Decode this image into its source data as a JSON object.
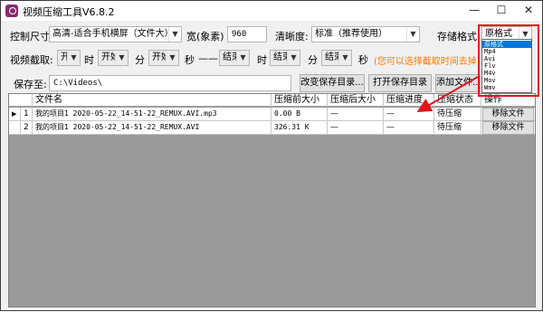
{
  "window": {
    "title": "视频压缩工具V6.8.2",
    "minimize": "—",
    "maximize": "☐",
    "close": "✕"
  },
  "row1": {
    "control_size_label": "控制尺寸:",
    "control_size_value": "高清-适合手机横屏（文件大）",
    "width_label": "宽(象素)",
    "width_value": "960",
    "clarity_label": "清晰度:",
    "clarity_value": "标准（推荐使用）",
    "format_label": "存储格式:",
    "format_value": "原格式"
  },
  "row2": {
    "clip_label": "视频截取:",
    "start_hour": "开始",
    "hour_unit": "时",
    "start_min": "开始",
    "min_unit": "分",
    "start_sec": "开始",
    "sec_unit": "秒",
    "dash": "——",
    "end_hour": "结束",
    "hour_unit2": "时",
    "end_min": "结束",
    "min_unit2": "分",
    "end_sec": "结束",
    "sec_unit2": "秒",
    "hint": "(您可以选择截取时间去掉《爱奇"
  },
  "row3": {
    "save_label": "保存至:",
    "save_path": "C:\\Videos\\",
    "change_dir_button": "改变保存目录...",
    "open_dir_button": "打开保存目录",
    "add_file_button": "添加文件..."
  },
  "grid": {
    "columns": [
      "文件名",
      "压缩前大小",
      "压缩后大小",
      "压缩进度",
      "压缩状态",
      "操作"
    ],
    "rows": [
      {
        "pointer": "▶",
        "index": "1",
        "filename": "我的项目1 2020-05-22_14-51-22_REMUX.AVI.mp3",
        "before": "0.00 B",
        "after": "—",
        "progress": "—",
        "status": "待压缩",
        "action": "移除文件"
      },
      {
        "pointer": "",
        "index": "2",
        "filename": "我的项目1 2020-05-22_14-51-22_REMUX.AVI",
        "before": "326.31 K",
        "after": "—",
        "progress": "—",
        "status": "待压缩",
        "action": "移除文件"
      }
    ]
  },
  "format_dropdown": {
    "options": [
      "原格式",
      "Mp4",
      "Avi",
      "Flv",
      "M4v",
      "Mov",
      "Wmv"
    ],
    "selected": "原格式"
  },
  "colors": {
    "highlight": "#e0141e",
    "selection": "#0078d7",
    "hint": "#ff7a00",
    "app_icon": "#8a2a6e"
  }
}
